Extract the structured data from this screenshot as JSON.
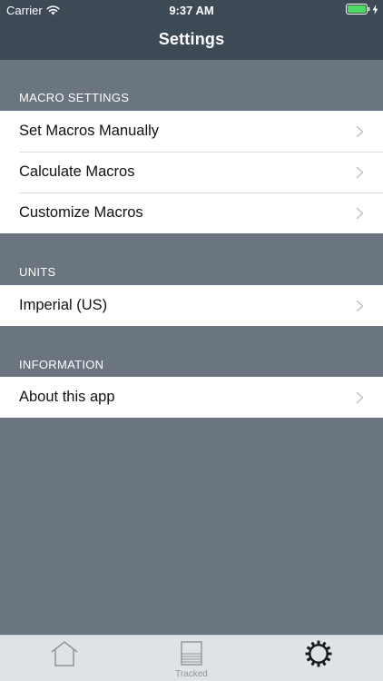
{
  "status_bar": {
    "carrier": "Carrier",
    "time": "9:37 AM",
    "battery_level_percent": 100,
    "battery_color": "#4cd964",
    "wifi_icon": "wifi-icon",
    "charging_icon": "bolt-icon"
  },
  "nav": {
    "title": "Settings"
  },
  "sections": {
    "macro": {
      "header": "MACRO SETTINGS",
      "rows": [
        {
          "label": "Set Macros Manually"
        },
        {
          "label": "Calculate Macros"
        },
        {
          "label": "Customize Macros"
        }
      ]
    },
    "units": {
      "header": "UNITS",
      "rows": [
        {
          "label": "Imperial (US)"
        }
      ]
    },
    "information": {
      "header": "INFORMATION",
      "rows": [
        {
          "label": "About this app"
        }
      ]
    }
  },
  "tab_bar": {
    "tabs": [
      {
        "icon": "home-icon",
        "label": ""
      },
      {
        "icon": "tracked-icon",
        "label": "Tracked"
      },
      {
        "icon": "gear-icon",
        "label": "",
        "selected": true
      }
    ]
  },
  "colors": {
    "nav_background": "#3d4a56",
    "page_background": "#6a7580",
    "tab_bar_background": "#dfe2e6",
    "selected_tab_icon": "#1c1c1c",
    "unselected_tab_icon": "#8f959b"
  }
}
